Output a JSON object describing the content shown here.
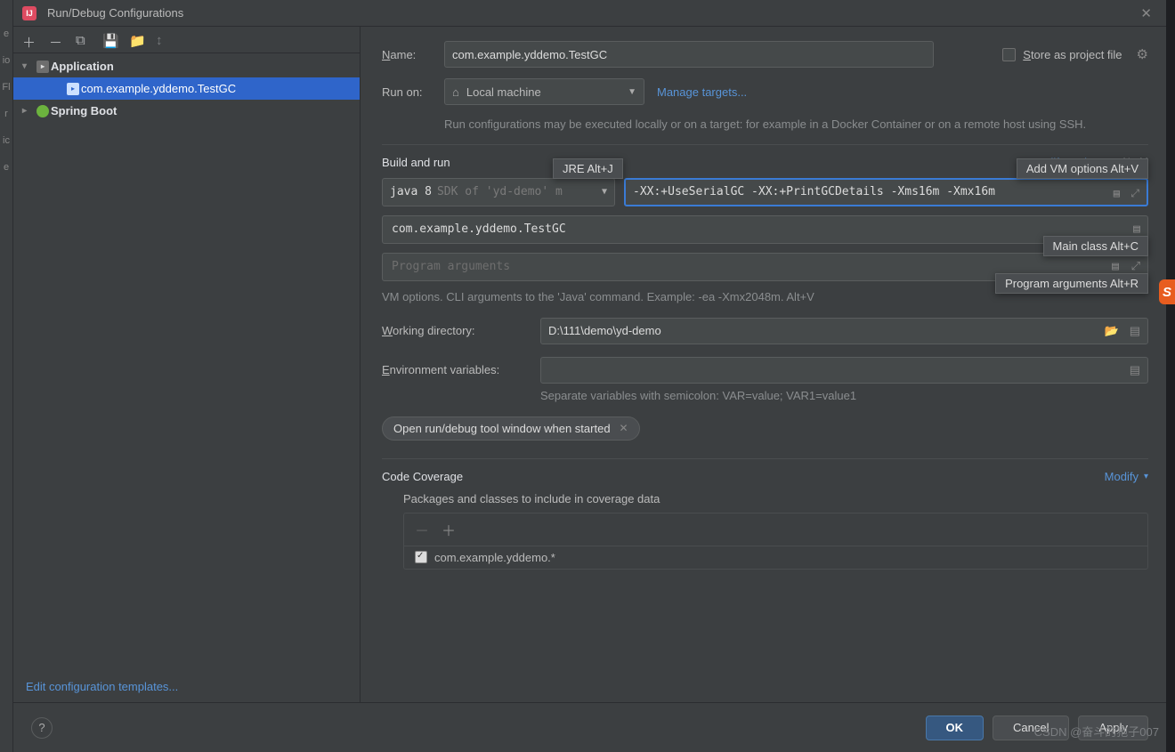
{
  "titlebar": {
    "title": "Run/Debug Configurations"
  },
  "leftstrip": {
    "items": [
      "e",
      "io",
      "Fl",
      "r",
      "ic",
      "e"
    ]
  },
  "sidebar": {
    "groups": [
      {
        "label": "Application",
        "expanded": true,
        "items": [
          {
            "label": "com.example.yddemo.TestGC"
          }
        ]
      },
      {
        "label": "Spring Boot",
        "expanded": false,
        "items": []
      }
    ],
    "edit_templates": "Edit configuration templates..."
  },
  "form": {
    "name_label": "Name:",
    "name_value": "com.example.yddemo.TestGC",
    "store_project": "Store as project file",
    "run_on_label": "Run on:",
    "run_on_value": "Local machine",
    "manage_targets": "Manage targets...",
    "run_on_hint": "Run configurations may be executed locally or on a target: for example in a Docker Container or on a remote host using SSH.",
    "build_run": "Build and run",
    "modify_options": "Modify options",
    "modify_hotkey": "Alt+M",
    "jre_tooltip": "JRE Alt+J",
    "add_vm_tooltip": "Add VM options Alt+V",
    "main_class_tooltip": "Main class Alt+C",
    "program_args_tooltip": "Program arguments Alt+R",
    "jre_primary": "java 8",
    "jre_secondary": "SDK of 'yd-demo' m",
    "vm_options_value": "-XX:+UseSerialGC -XX:+PrintGCDetails -Xms16m -Xmx16m",
    "main_class_value": "com.example.yddemo.TestGC",
    "program_args_placeholder": "Program arguments",
    "vm_help": "VM options. CLI arguments to the 'Java' command. Example: -ea -Xmx2048m. Alt+V",
    "working_dir_label": "Working directory:",
    "working_dir_value": "D:\\111\\demo\\yd-demo",
    "env_label": "Environment variables:",
    "env_value": "",
    "env_hint": "Separate variables with semicolon: VAR=value; VAR1=value1",
    "chip_label": "Open run/debug tool window when started",
    "code_coverage": "Code Coverage",
    "modify_link": "Modify",
    "coverage_include": "Packages and classes to include in coverage data",
    "coverage_item": "com.example.yddemo.*"
  },
  "footer": {
    "ok": "OK",
    "cancel": "Cancel",
    "apply": "Apply"
  },
  "watermark": "CSDN @奋斗的狍子007"
}
